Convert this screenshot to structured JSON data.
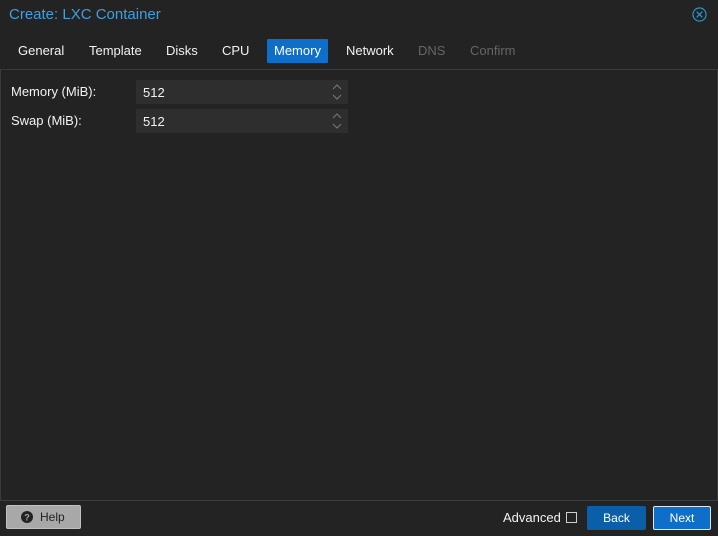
{
  "window": {
    "title": "Create: LXC Container",
    "close_icon": "circle-x-icon"
  },
  "tabs": [
    {
      "label": "General",
      "state": "normal"
    },
    {
      "label": "Template",
      "state": "normal"
    },
    {
      "label": "Disks",
      "state": "normal"
    },
    {
      "label": "CPU",
      "state": "normal"
    },
    {
      "label": "Memory",
      "state": "active"
    },
    {
      "label": "Network",
      "state": "normal"
    },
    {
      "label": "DNS",
      "state": "disabled"
    },
    {
      "label": "Confirm",
      "state": "disabled"
    }
  ],
  "form": {
    "memory": {
      "label": "Memory (MiB):",
      "value": "512"
    },
    "swap": {
      "label": "Swap (MiB):",
      "value": "512"
    }
  },
  "footer": {
    "help_label": "Help",
    "help_icon": "question-circle-icon",
    "advanced_label": "Advanced",
    "advanced_checked": false,
    "back_label": "Back",
    "next_label": "Next"
  },
  "colors": {
    "accent": "#0d6fc9",
    "title": "#3f9fe0",
    "background": "#232323"
  }
}
